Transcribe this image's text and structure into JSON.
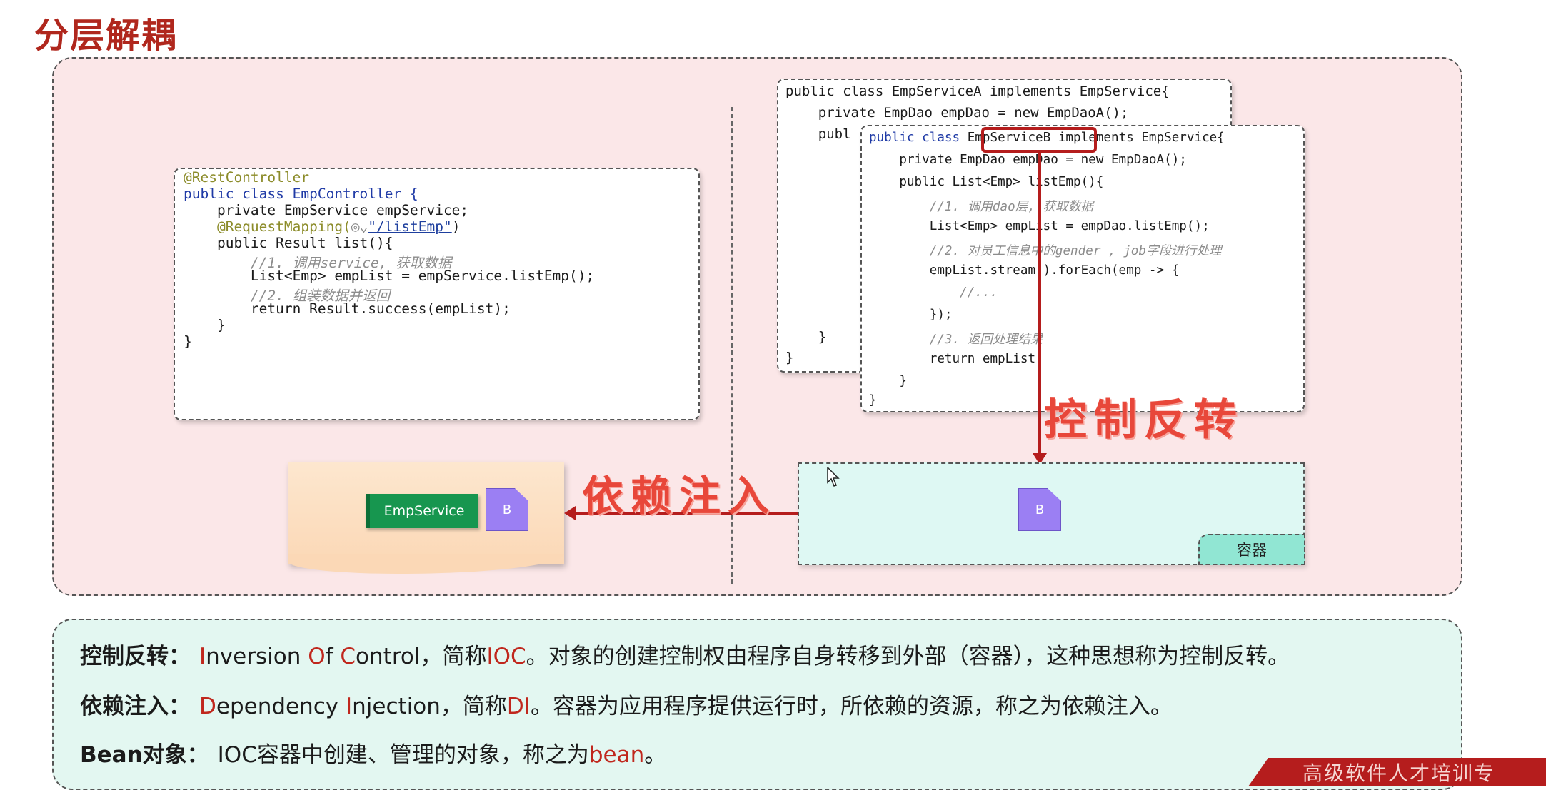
{
  "title": "分层解耦",
  "controller_code": [
    "@RestController",
    "public class EmpController {",
    "    private EmpService empService;",
    "    @RequestMapping(",
    "\"/listEmp\"",
    ")",
    "    public Result list(){",
    "        //1. 调用service, 获取数据",
    "        List<Emp> empList = empService.listEmp();",
    "        //2. 组装数据并返回",
    "        return Result.success(empList);",
    "    }",
    "}"
  ],
  "service_a_code": [
    "public class EmpServiceA implements EmpService{",
    "    private EmpDao empDao = new EmpDaoA();",
    "    publ",
    "    }",
    "}"
  ],
  "service_b_code": {
    "line1_prefix": "public class ",
    "line1_class": "EmpServiceB",
    "line1_suffix": " implements EmpService{",
    "line2": "    private EmpDao empDao = new EmpDaoA();",
    "line3": "    public List<Emp> listEmp(){",
    "line4": "        //1. 调用dao层, 获取数据",
    "line5": "        List<Emp> empList = empDao.listEmp();",
    "line6": "        //2. 对员工信息中的gender , job字段进行处理",
    "line7": "        empList.stream().forEach(emp -> {",
    "line8": "            //...",
    "line9": "        });",
    "line10": "        //3. 返回处理结果",
    "line11": "        return empList;",
    "line12": "    }",
    "line13": "}"
  },
  "labels": {
    "ioc": "控制反转",
    "di": "依赖注入",
    "empservice_tag": "EmpService",
    "bean_letter": "B",
    "container": "容器"
  },
  "definitions": {
    "ioc_term": "控制反转：",
    "ioc_I": "I",
    "ioc_nversion": "nversion ",
    "ioc_O": "O",
    "ioc_f": "f ",
    "ioc_C": "C",
    "ioc_ontrol": "ontrol，简称",
    "ioc_abbr": "IOC",
    "ioc_rest": "。对象的创建控制权由程序自身转移到外部（容器），这种思想称为控制反转。",
    "di_term": "依赖注入：",
    "di_D": "D",
    "di_ependency": "ependency ",
    "di_I": "I",
    "di_njection": "njection，简称",
    "di_abbr": "DI",
    "di_rest": "。容器为应用程序提供运行时，所依赖的资源，称之为依赖注入。",
    "bean_term": "Bean对象：",
    "bean_text": "IOC容器中创建、管理的对象，称之为",
    "bean_word": "bean",
    "bean_end": "。"
  },
  "footer_ribbon": "高级软件人才培训专",
  "colors": {
    "accent_red": "#b51d1d",
    "upper_bg": "#fbe7e8",
    "lower_bg": "#e3f7f1",
    "bean_purple": "#9b7ff3",
    "tag_green": "#17964f"
  }
}
